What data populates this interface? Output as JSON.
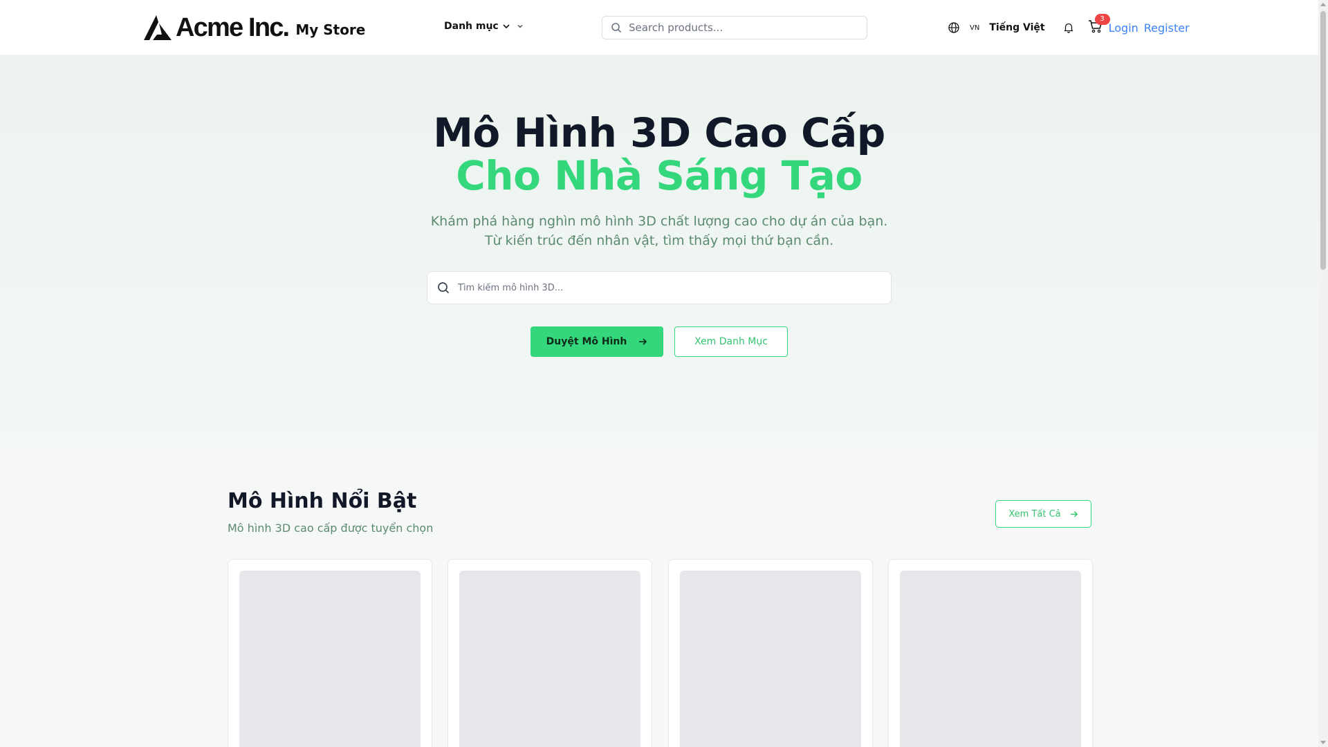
{
  "header": {
    "brand_name": "Acme Inc.",
    "store_name": "My Store",
    "category_menu_label": "Danh mục",
    "search_placeholder": "Search products...",
    "lang_code": "VN",
    "lang_name": "Tiếng Việt",
    "cart_count": "3",
    "login_label": "Login",
    "register_label": "Register"
  },
  "hero": {
    "title_line1": "Mô Hình 3D Cao Cấp",
    "title_line2": "Cho Nhà Sáng Tạo",
    "subtitle": "Khám phá hàng nghìn mô hình 3D chất lượng cao cho dự án của bạn. Từ kiến trúc đến nhân vật, tìm thấy mọi thứ bạn cần.",
    "search_placeholder": "Tìm kiếm mô hình 3D...",
    "primary_button": "Duyệt Mô Hình",
    "secondary_button": "Xem Danh Mục"
  },
  "featured": {
    "title": "Mô Hình Nổi Bật",
    "subtitle": "Mô hình 3D cao cấp được tuyển chọn",
    "view_all": "Xem Tất Cả",
    "card_count": 4
  },
  "colors": {
    "accent": "#34d77b",
    "link": "#3b82f6",
    "badge": "#ef4444",
    "muted_green": "#5b8a6f"
  },
  "icons": [
    "brand-logo-icon",
    "chevron-down-icon",
    "search-icon",
    "globe-icon",
    "bell-icon",
    "cart-icon",
    "arrow-right-icon"
  ]
}
